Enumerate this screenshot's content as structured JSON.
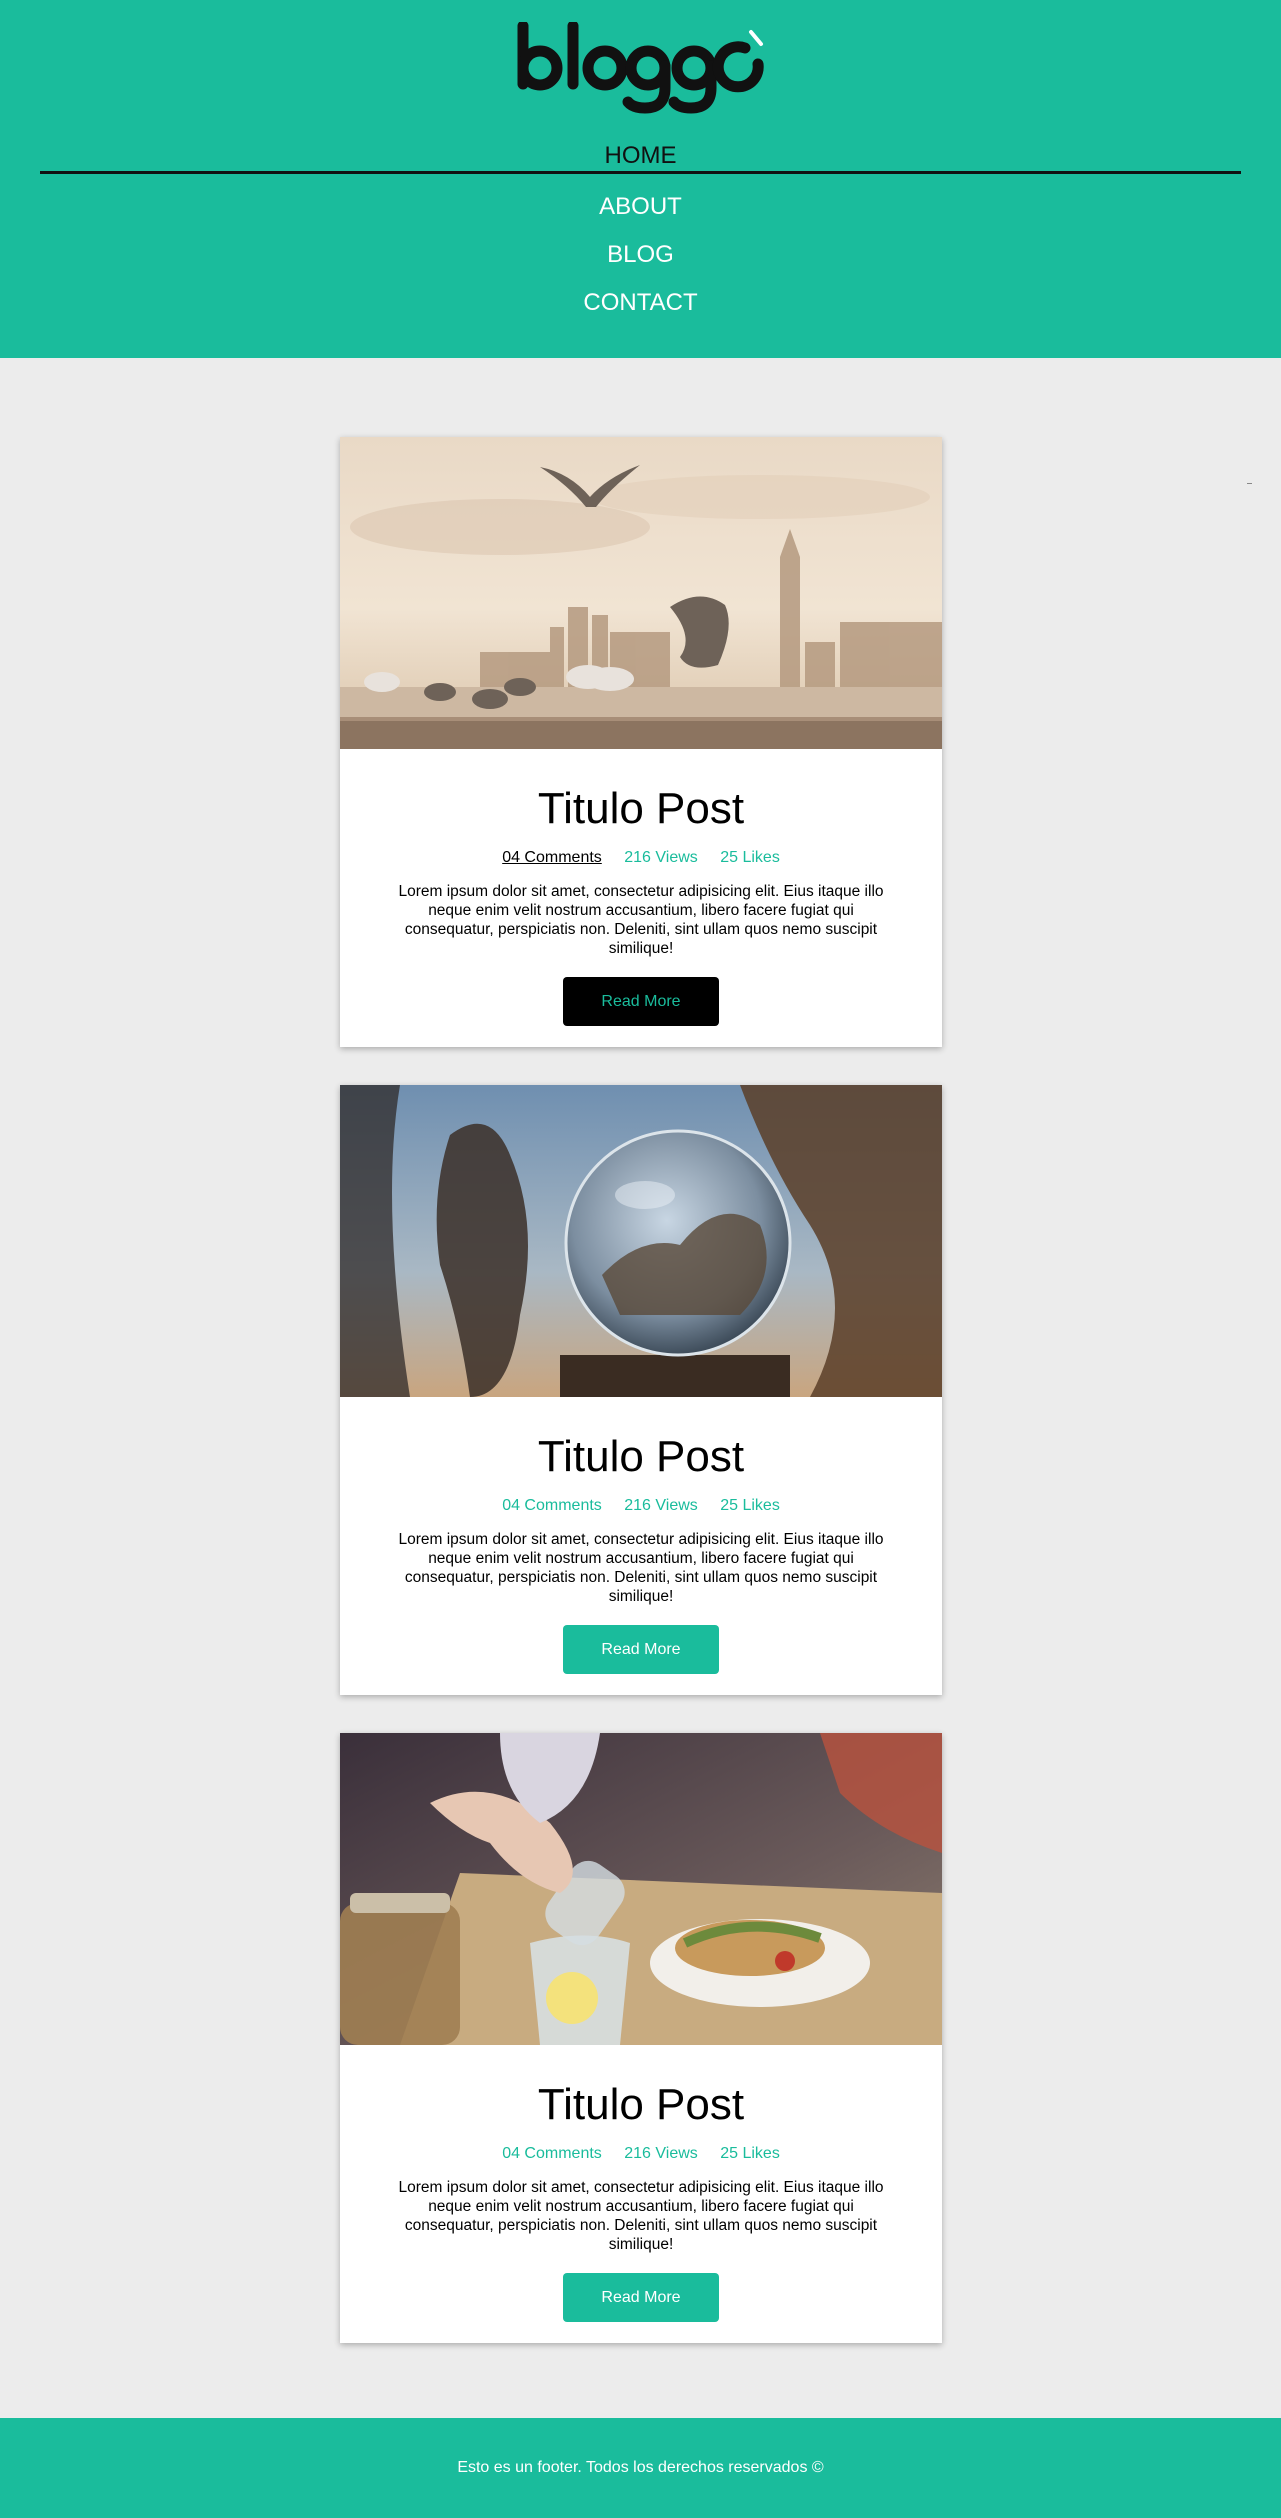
{
  "header": {
    "logo_text": "bloggo",
    "nav": [
      {
        "label": "HOME",
        "active": true
      },
      {
        "label": "ABOUT"
      },
      {
        "label": "BLOG"
      },
      {
        "label": "CONTACT"
      }
    ]
  },
  "posts": [
    {
      "image": "city-birds-photo",
      "title": "Titulo Post",
      "comments": "04 Comments",
      "views": "216 Views",
      "likes": "25 Likes",
      "excerpt": "Lorem ipsum dolor sit amet, consectetur adipisicing elit. Eius itaque illo neque enim velit nostrum accusantium, libero facere fugiat qui consequatur, perspiciatis non. Deleniti, sint ullam quos nemo suscipit similique!",
      "button": "Read More"
    },
    {
      "image": "crystal-ball-photo",
      "title": "Titulo Post",
      "comments": "04 Comments",
      "views": "216 Views",
      "likes": "25 Likes",
      "excerpt": "Lorem ipsum dolor sit amet, consectetur adipisicing elit. Eius itaque illo neque enim velit nostrum accusantium, libero facere fugiat qui consequatur, perspiciatis non. Deleniti, sint ullam quos nemo suscipit similique!",
      "button": "Read More"
    },
    {
      "image": "restaurant-table-photo",
      "title": "Titulo Post",
      "comments": "04 Comments",
      "views": "216 Views",
      "likes": "25 Likes",
      "excerpt": "Lorem ipsum dolor sit amet, consectetur adipisicing elit. Eius itaque illo neque enim velit nostrum accusantium, libero facere fugiat qui consequatur, perspiciatis non. Deleniti, sint ullam quos nemo suscipit similique!",
      "button": "Read More"
    }
  ],
  "footer": {
    "text": "Esto es un footer. Todos los derechos reservados ©"
  },
  "colors": {
    "brand": "#1abc9c",
    "page_background": "#ececec",
    "card_background": "#ffffff",
    "text": "#000000"
  }
}
